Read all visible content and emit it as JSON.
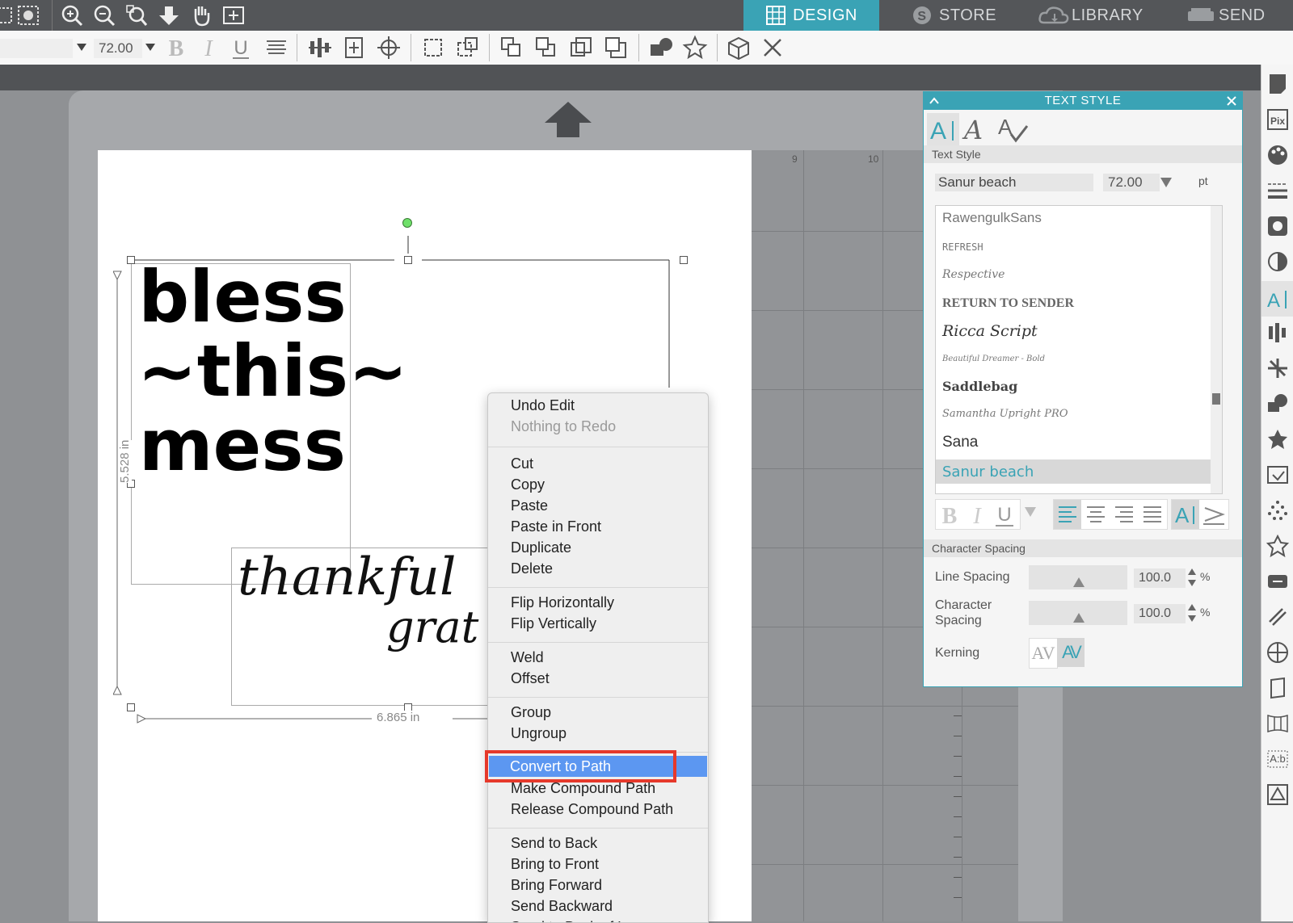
{
  "nav": {
    "design": "DESIGN",
    "store": "STORE",
    "library": "LIBRARY",
    "send": "SEND"
  },
  "toolbar": {
    "font_size": "72.00"
  },
  "panel": {
    "title": "TEXT STYLE",
    "section_text_style": "Text Style",
    "font_name": "Sanur beach",
    "font_size": "72.00",
    "unit": "pt",
    "fonts": [
      "RawengulkSans",
      "REFRESH",
      "Respective",
      "RETURN TO SENDER",
      "Ricca Script",
      "Beautiful Dreamer - Bold",
      "Saddlebag",
      "Samantha Upright PRO",
      "Sana",
      "Sanur beach"
    ],
    "section_char_spacing": "Character Spacing",
    "line_spacing_label": "Line Spacing",
    "line_spacing_value": "100.0",
    "char_spacing_label_1": "Character",
    "char_spacing_label_2": "Spacing",
    "char_spacing_value": "100.0",
    "percent": "%",
    "kerning_label": "Kerning",
    "kerning_glyph": "AV"
  },
  "canvas": {
    "ruler_9": "9",
    "ruler_10": "10",
    "height_dim": "5.528 in",
    "width_dim": "6.865 in",
    "design_line1": "bless",
    "design_line2": "~this~",
    "design_line3": "mess",
    "script_line1": "thankful",
    "script_line2": "grat"
  },
  "menu": {
    "undo": "Undo Edit",
    "redo": "Nothing to Redo",
    "cut": "Cut",
    "copy": "Copy",
    "paste": "Paste",
    "paste_front": "Paste in Front",
    "duplicate": "Duplicate",
    "delete": "Delete",
    "flip_h": "Flip Horizontally",
    "flip_v": "Flip Vertically",
    "weld": "Weld",
    "offset": "Offset",
    "group": "Group",
    "ungroup": "Ungroup",
    "convert_path": "Convert to Path",
    "make_compound": "Make Compound Path",
    "release_compound": "Release Compound Path",
    "send_back": "Send to Back",
    "bring_front": "Bring to Front",
    "bring_forward": "Bring Forward",
    "send_backward": "Send Backward",
    "send_back_layer": "Send to Back of Layer"
  },
  "colors": {
    "accent": "#3aa3b5",
    "highlight": "#5c97f1",
    "annotation": "#e6392b"
  }
}
